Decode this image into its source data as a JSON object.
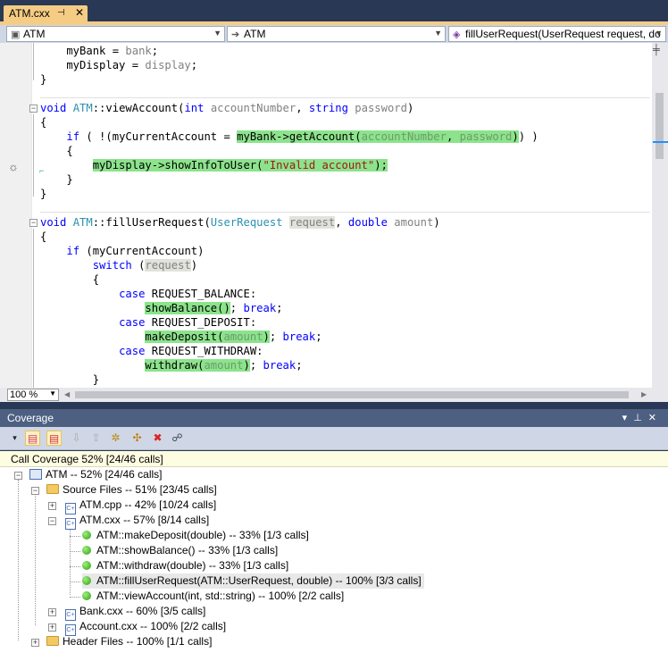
{
  "editor_tab": {
    "title": "ATM.cxx",
    "pin_icon": "pin-icon",
    "close_label": "✕"
  },
  "navbar": {
    "project": "ATM",
    "scope": "ATM",
    "member": "fillUserRequest(UserRequest request, do"
  },
  "code_lines": [
    {
      "parts": [
        {
          "t": "    myBank = "
        },
        {
          "t": "bank",
          "c": "pa"
        },
        {
          "t": ";"
        }
      ]
    },
    {
      "parts": [
        {
          "t": "    myDisplay = "
        },
        {
          "t": "display",
          "c": "pa"
        },
        {
          "t": ";"
        }
      ]
    },
    {
      "parts": [
        {
          "t": "}"
        }
      ]
    },
    {
      "parts": [
        {
          "t": ""
        }
      ]
    },
    {
      "parts": [
        {
          "t": "void",
          "c": "kw"
        },
        {
          "t": " "
        },
        {
          "t": "ATM",
          "c": "ty"
        },
        {
          "t": "::viewAccount("
        },
        {
          "t": "int",
          "c": "kw"
        },
        {
          "t": " "
        },
        {
          "t": "accountNumber",
          "c": "pa"
        },
        {
          "t": ", "
        },
        {
          "t": "string",
          "c": "kw"
        },
        {
          "t": " "
        },
        {
          "t": "password",
          "c": "pa"
        },
        {
          "t": ")"
        }
      ]
    },
    {
      "parts": [
        {
          "t": "{"
        }
      ]
    },
    {
      "parts": [
        {
          "t": "    "
        },
        {
          "t": "if",
          "c": "kw"
        },
        {
          "t": " ( !(myCurrentAccount = "
        },
        {
          "t": "myBank->getAccount(",
          "c": "hl"
        },
        {
          "t": "accountNumber",
          "c": "hlp"
        },
        {
          "t": ", ",
          "c": "hl"
        },
        {
          "t": "password",
          "c": "hlp"
        },
        {
          "t": ")",
          "c": "hl"
        },
        {
          "t": ") )"
        }
      ]
    },
    {
      "parts": [
        {
          "t": "    {"
        }
      ]
    },
    {
      "parts": [
        {
          "t": "        "
        },
        {
          "t": "myDisplay->showInfoToUser(",
          "c": "hl"
        },
        {
          "t": "\"Invalid account\"",
          "c": "hls"
        },
        {
          "t": ");",
          "c": "hl"
        }
      ]
    },
    {
      "parts": [
        {
          "t": "    }"
        }
      ]
    },
    {
      "parts": [
        {
          "t": "}"
        }
      ]
    },
    {
      "parts": [
        {
          "t": ""
        }
      ]
    },
    {
      "parts": [
        {
          "t": "void",
          "c": "kw"
        },
        {
          "t": " "
        },
        {
          "t": "ATM",
          "c": "ty"
        },
        {
          "t": "::fillUserRequest("
        },
        {
          "t": "UserRequest",
          "c": "ty"
        },
        {
          "t": " "
        },
        {
          "t": "request",
          "c": "hlr"
        },
        {
          "t": ", "
        },
        {
          "t": "double",
          "c": "kw"
        },
        {
          "t": " "
        },
        {
          "t": "amount",
          "c": "pa"
        },
        {
          "t": ")"
        }
      ]
    },
    {
      "parts": [
        {
          "t": "{"
        }
      ]
    },
    {
      "parts": [
        {
          "t": "    "
        },
        {
          "t": "if",
          "c": "kw"
        },
        {
          "t": " (myCurrentAccount)"
        }
      ]
    },
    {
      "parts": [
        {
          "t": "        "
        },
        {
          "t": "switch",
          "c": "kw"
        },
        {
          "t": " ("
        },
        {
          "t": "request",
          "c": "hlr"
        },
        {
          "t": ")"
        }
      ]
    },
    {
      "parts": [
        {
          "t": "        {"
        }
      ]
    },
    {
      "parts": [
        {
          "t": "            "
        },
        {
          "t": "case",
          "c": "kw"
        },
        {
          "t": " REQUEST_BALANCE:"
        }
      ]
    },
    {
      "parts": [
        {
          "t": "                "
        },
        {
          "t": "showBalance()",
          "c": "hl"
        },
        {
          "t": "; "
        },
        {
          "t": "break",
          "c": "kw"
        },
        {
          "t": ";"
        }
      ]
    },
    {
      "parts": [
        {
          "t": "            "
        },
        {
          "t": "case",
          "c": "kw"
        },
        {
          "t": " REQUEST_DEPOSIT:"
        }
      ]
    },
    {
      "parts": [
        {
          "t": "                "
        },
        {
          "t": "makeDeposit(",
          "c": "hl"
        },
        {
          "t": "amount",
          "c": "hlp"
        },
        {
          "t": ")",
          "c": "hl"
        },
        {
          "t": "; "
        },
        {
          "t": "break",
          "c": "kw"
        },
        {
          "t": ";"
        }
      ]
    },
    {
      "parts": [
        {
          "t": "            "
        },
        {
          "t": "case",
          "c": "kw"
        },
        {
          "t": " REQUEST_WITHDRAW:"
        }
      ]
    },
    {
      "parts": [
        {
          "t": "                "
        },
        {
          "t": "withdraw(",
          "c": "hl"
        },
        {
          "t": "amount",
          "c": "hlp"
        },
        {
          "t": ")",
          "c": "hl"
        },
        {
          "t": "; "
        },
        {
          "t": "break",
          "c": "kw"
        },
        {
          "t": ";"
        }
      ]
    },
    {
      "parts": [
        {
          "t": "        }"
        }
      ]
    }
  ],
  "zoom": "100 %",
  "coverage_panel": {
    "title": "Coverage",
    "summary": "Call Coverage 52% [24/46 calls]",
    "tree": [
      {
        "label": "ATM -- 52% [24/46 calls]",
        "icon": "project-icon"
      },
      {
        "label": "Source Files -- 51% [23/45 calls]",
        "icon": "folder-icon"
      },
      {
        "label": "ATM.cpp -- 42% [10/24 calls]",
        "icon": "cpp-file-icon"
      },
      {
        "label": "ATM.cxx -- 57% [8/14 calls]",
        "icon": "cpp-file-icon"
      },
      {
        "label": "ATM::makeDeposit(double) -- 33% [1/3 calls]",
        "icon": "covered-ball-icon"
      },
      {
        "label": "ATM::showBalance() -- 33% [1/3 calls]",
        "icon": "covered-ball-icon"
      },
      {
        "label": "ATM::withdraw(double) -- 33% [1/3 calls]",
        "icon": "covered-ball-icon"
      },
      {
        "label": "ATM::fillUserRequest(ATM::UserRequest, double) -- 100% [3/3 calls]",
        "icon": "covered-ball-icon"
      },
      {
        "label": "ATM::viewAccount(int, std::string) -- 100% [2/2 calls]",
        "icon": "covered-ball-icon"
      },
      {
        "label": "Bank.cxx -- 60% [3/5 calls]",
        "icon": "cpp-file-icon"
      },
      {
        "label": "Account.cxx -- 100% [2/2 calls]",
        "icon": "cpp-file-icon"
      },
      {
        "label": "Header Files -- 100% [1/1 calls]",
        "icon": "folder-icon"
      }
    ]
  },
  "colors": {
    "highlight_covered": "#8ce38c",
    "panel_title": "#4d6082",
    "tab_active": "#f5cc84",
    "scope_marker": "#1e90ff"
  }
}
